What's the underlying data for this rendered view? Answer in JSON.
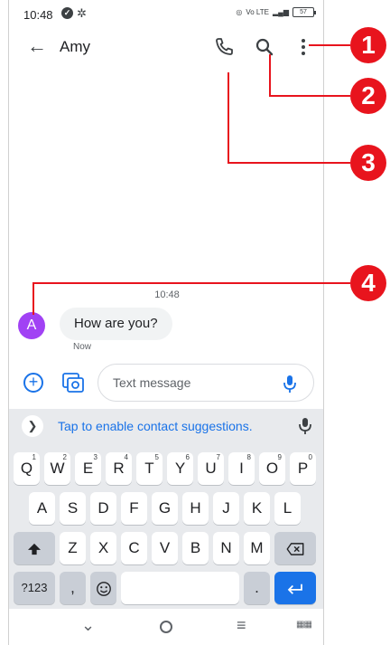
{
  "status_bar": {
    "time": "10:48",
    "left_icons": [
      "notification-badge-icon",
      "gear-icon"
    ],
    "right_text": "Vo LTE",
    "battery": "57"
  },
  "app_bar": {
    "back_icon": "arrow-left-icon",
    "contact_name": "Amy",
    "actions": [
      "phone-icon",
      "search-icon",
      "more-vert-icon"
    ]
  },
  "conversation": {
    "timestamp": "10:48",
    "messages": [
      {
        "avatar_letter": "A",
        "text": "How are you?",
        "time": "Now"
      }
    ]
  },
  "compose": {
    "placeholder": "Text message"
  },
  "keyboard": {
    "suggestion_text": "Tap to enable contact suggestions.",
    "row1": [
      {
        "label": "Q",
        "sup": "1"
      },
      {
        "label": "W",
        "sup": "2"
      },
      {
        "label": "E",
        "sup": "3"
      },
      {
        "label": "R",
        "sup": "4"
      },
      {
        "label": "T",
        "sup": "5"
      },
      {
        "label": "Y",
        "sup": "6"
      },
      {
        "label": "U",
        "sup": "7"
      },
      {
        "label": "I",
        "sup": "8"
      },
      {
        "label": "O",
        "sup": "9"
      },
      {
        "label": "P",
        "sup": "0"
      }
    ],
    "row2": [
      "A",
      "S",
      "D",
      "F",
      "G",
      "H",
      "J",
      "K",
      "L"
    ],
    "row3": [
      "Z",
      "X",
      "C",
      "V",
      "B",
      "N",
      "M"
    ],
    "row4": {
      "symbols": "?123",
      "comma": ",",
      "period": "."
    }
  },
  "annotations": [
    "1",
    "2",
    "3",
    "4"
  ],
  "colors": {
    "callout": "#e8141d",
    "accent": "#1a73e8",
    "avatar": "#a142f4"
  }
}
